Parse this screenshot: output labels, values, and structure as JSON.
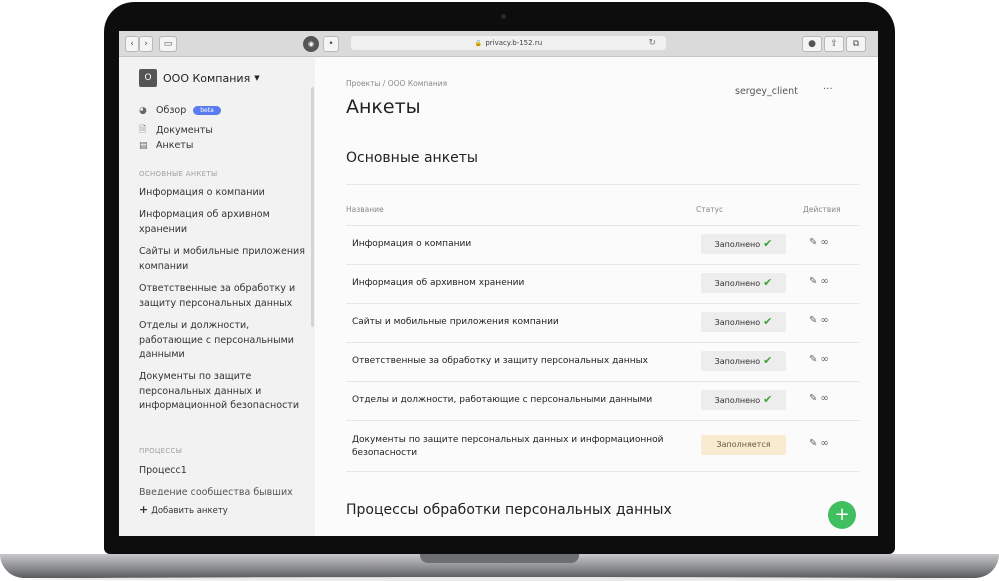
{
  "browser": {
    "url": "privacy.b-152.ru",
    "back_icon": "chevron-left-icon",
    "forward_icon": "chevron-right-icon"
  },
  "sidebar": {
    "org_badge": "О",
    "org_name": "ООО Компания",
    "nav": [
      {
        "label": "Обзор",
        "icon": "pie-chart-icon",
        "badge": "beta"
      },
      {
        "label": "Документы",
        "icon": "document-icon"
      },
      {
        "label": "Анкеты",
        "icon": "form-icon"
      }
    ],
    "section_forms": "ОСНОВНЫЕ АНКЕТЫ",
    "form_items": [
      "Информация о компании",
      "Информация об архивном хранении",
      "Сайты и мобильные приложения компании",
      "Ответственные за обработку и защиту персональных данных",
      "Отделы и должности, работающие с персональными данными",
      "Документы по защите персональных данных и информационной безопасности"
    ],
    "section_processes": "ПРОЦЕССЫ",
    "process_items": [
      "Процесс1",
      "Введение сообщества бывших"
    ],
    "add_label": "Добавить анкету"
  },
  "main": {
    "breadcrumb": "Проекты  /  ООО Компания",
    "title": "Анкеты",
    "user": "sergey_client",
    "more": "···",
    "section_title": "Основные анкеты",
    "columns": {
      "name": "Название",
      "status": "Статус",
      "actions": "Действия"
    },
    "rows": [
      {
        "name": "Информация о компании",
        "status": "Заполнено",
        "state": "done"
      },
      {
        "name": "Информация об архивном хранении",
        "status": "Заполнено",
        "state": "done"
      },
      {
        "name": "Сайты и мобильные приложения компании",
        "status": "Заполнено",
        "state": "done"
      },
      {
        "name": "Ответственные за обработку и защиту персональных данных",
        "status": "Заполнено",
        "state": "done"
      },
      {
        "name": "Отделы и должности, работающие с персональными данными",
        "status": "Заполнено",
        "state": "done"
      },
      {
        "name": "Документы по защите персональных данных и информационной безопасности",
        "status": "Заполняется",
        "state": "in-progress"
      }
    ],
    "section2_title": "Процессы обработки персональных данных",
    "colors": {
      "accent": "#3fbf5f",
      "beta": "#5b7cf0",
      "done_bg": "#ededed",
      "progress_bg": "#f8ebd0"
    }
  }
}
